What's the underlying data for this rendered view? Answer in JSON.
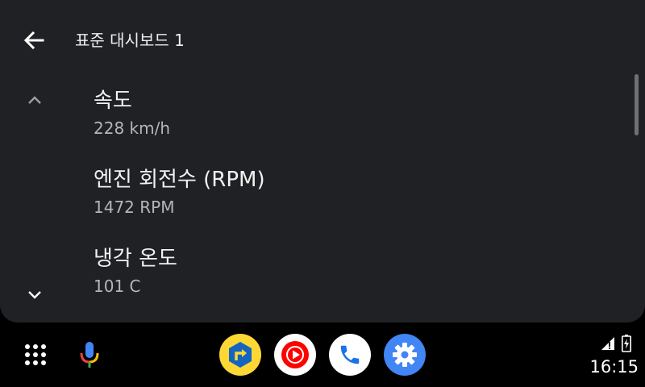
{
  "header": {
    "back_icon": "arrow-back-icon",
    "title": "표준 대시보드 1"
  },
  "list": {
    "items": [
      {
        "title": "속도",
        "value": "228 km/h"
      },
      {
        "title": "엔진 회전수 (RPM)",
        "value": "1472 RPM"
      },
      {
        "title": "냉각 온도",
        "value": "101 C"
      }
    ],
    "scroll_up_icon": "chevron-up-icon",
    "scroll_down_icon": "chevron-down-icon"
  },
  "rail": {
    "launcher_icon": "app-grid-icon",
    "mic_icon": "microphone-icon",
    "apps": [
      {
        "icon": "navigation-app-icon",
        "color": "#FDD835"
      },
      {
        "icon": "youtube-music-icon",
        "color": "#FF0000"
      },
      {
        "icon": "phone-icon",
        "color": "#1A73E8"
      },
      {
        "icon": "settings-icon",
        "color": "#4285F4"
      }
    ]
  },
  "status": {
    "signal_icon": "cell-signal-icon",
    "battery_icon": "battery-charging-icon",
    "time": "16:15"
  },
  "colors": {
    "panel_bg": "#202124",
    "accent_blue": "#4285F4"
  }
}
